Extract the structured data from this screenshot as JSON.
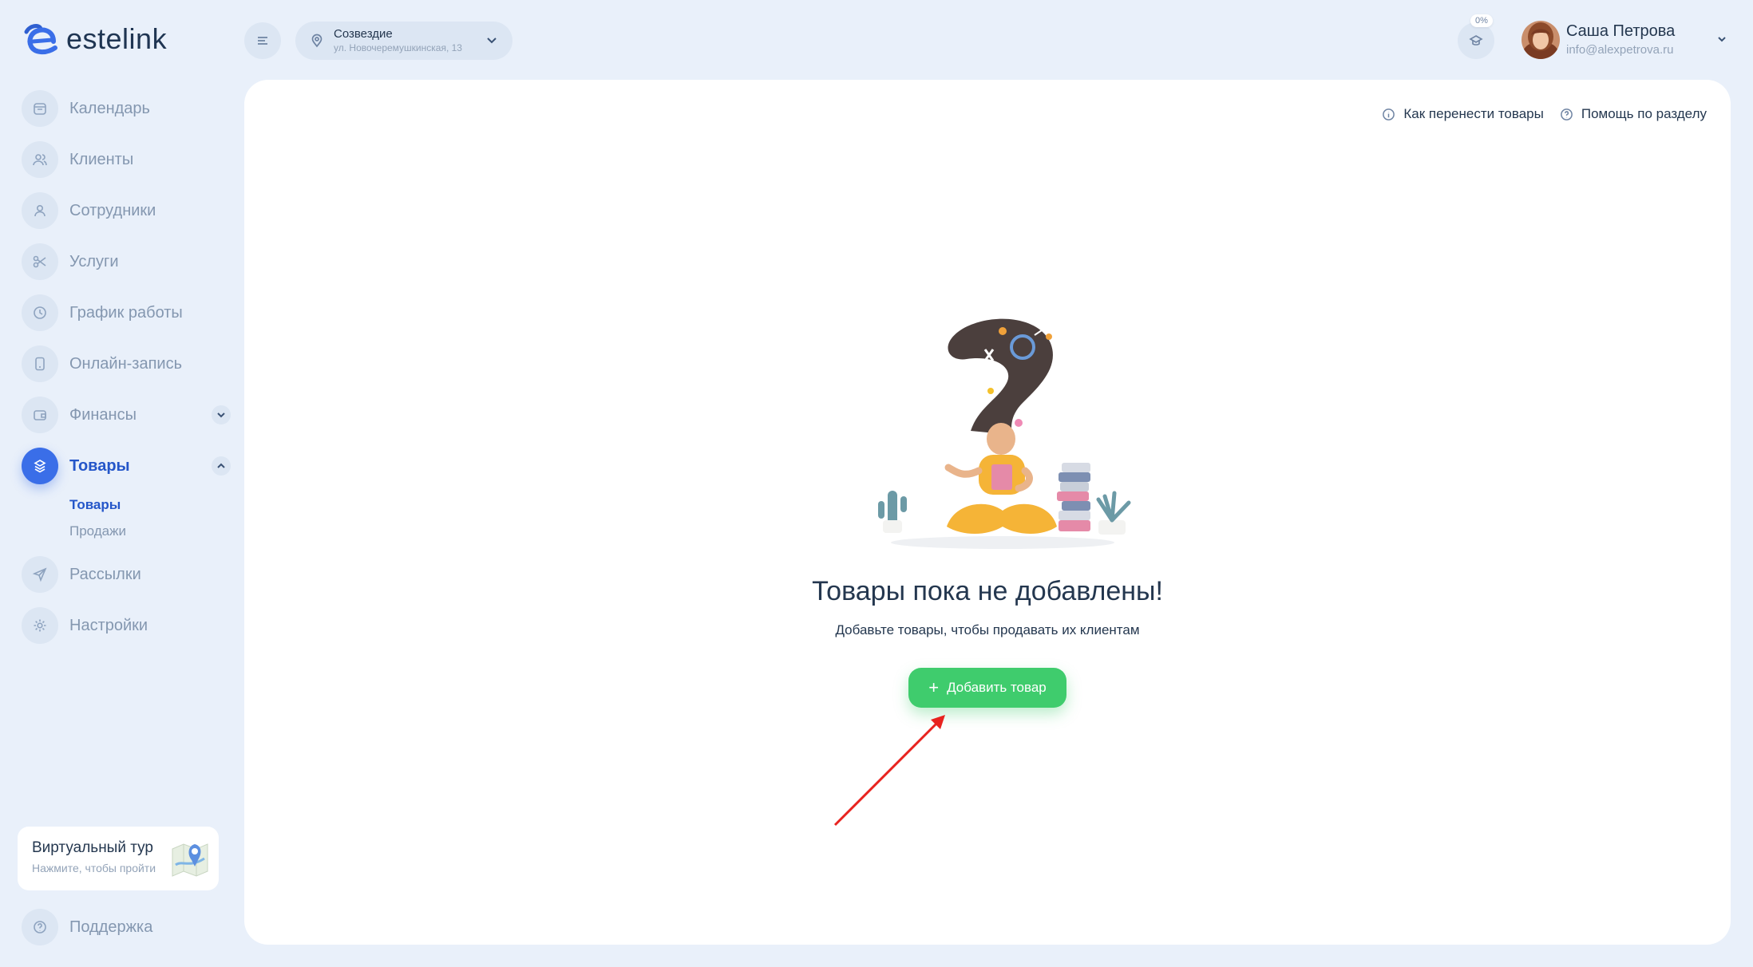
{
  "brand": {
    "name": "estelink"
  },
  "sidebar": {
    "items": [
      {
        "label": "Календарь",
        "icon": "calendar-icon"
      },
      {
        "label": "Клиенты",
        "icon": "clients-icon"
      },
      {
        "label": "Сотрудники",
        "icon": "user-icon"
      },
      {
        "label": "Услуги",
        "icon": "scissors-icon"
      },
      {
        "label": "График работы",
        "icon": "clock-icon"
      },
      {
        "label": "Онлайн-запись",
        "icon": "phone-icon"
      },
      {
        "label": "Финансы",
        "icon": "wallet-icon"
      },
      {
        "label": "Товары",
        "icon": "products-icon"
      },
      {
        "label": "Рассылки",
        "icon": "send-icon"
      },
      {
        "label": "Настройки",
        "icon": "gear-icon"
      }
    ],
    "products_sub": [
      {
        "label": "Товары"
      },
      {
        "label": "Продажи"
      }
    ],
    "tour": {
      "title": "Виртуальный тур",
      "subtitle": "Нажмите, чтобы пройти"
    },
    "support": {
      "label": "Поддержка"
    }
  },
  "header": {
    "location": {
      "name": "Созвездие",
      "address": "ул. Новочеремушкинская, 13"
    },
    "progress": "0%",
    "user": {
      "name": "Саша Петрова",
      "email": "info@alexpetrova.ru"
    }
  },
  "main": {
    "links": [
      {
        "label": "Как перенести товары"
      },
      {
        "label": "Помощь по разделу"
      }
    ],
    "empty_title": "Товары пока не добавлены!",
    "empty_subtitle": "Добавьте товары, чтобы продавать их клиентам",
    "add_button": "Добавить товар"
  },
  "colors": {
    "accent": "#3a6ee8",
    "success": "#3fcc6d",
    "background": "#e9f0fa",
    "annotation_arrow": "#e8231f"
  }
}
